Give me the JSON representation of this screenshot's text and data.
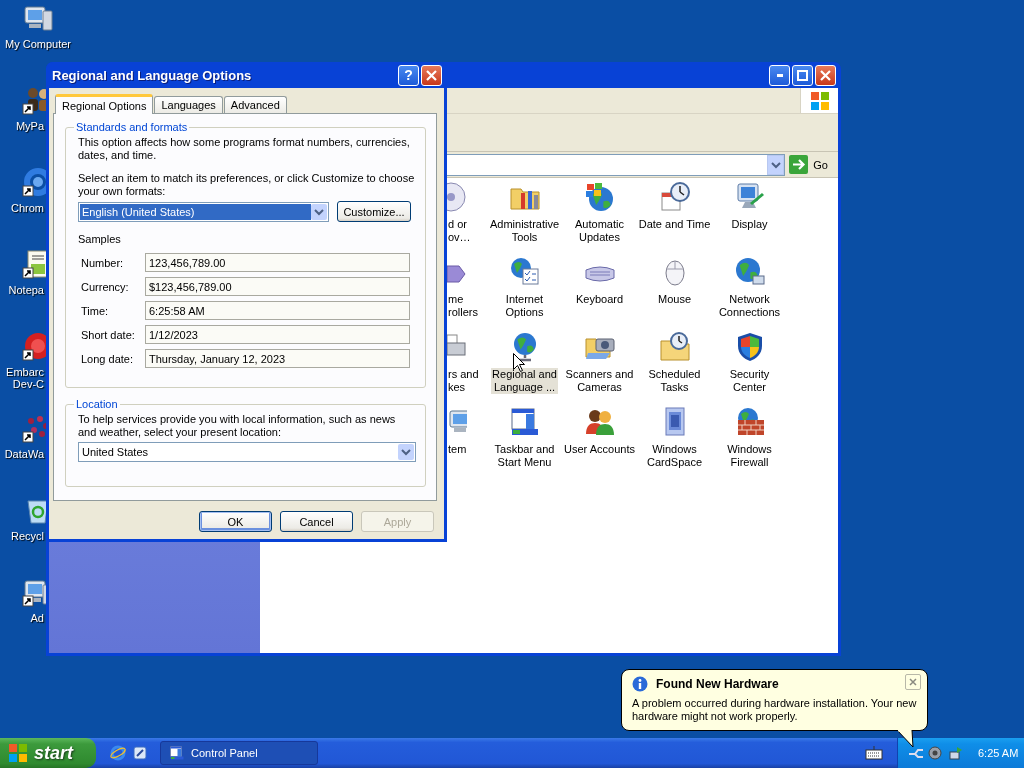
{
  "desktop_icons": [
    {
      "kind": "computer",
      "shortcut": false,
      "cut": false,
      "lines": [
        "My Computer"
      ]
    },
    {
      "kind": "figures",
      "shortcut": true,
      "cut": true,
      "lines": [
        "MyPa"
      ]
    },
    {
      "kind": "ring",
      "shortcut": true,
      "cut": true,
      "lines": [
        "Chrom"
      ]
    },
    {
      "kind": "notepad",
      "shortcut": true,
      "cut": true,
      "lines": [
        "Notepa"
      ]
    },
    {
      "kind": "badge",
      "shortcut": true,
      "cut": true,
      "lines": [
        "Embarc",
        "Dev-C"
      ]
    },
    {
      "kind": "dots",
      "shortcut": true,
      "cut": true,
      "lines": [
        "DataWa"
      ]
    },
    {
      "kind": "recycle",
      "shortcut": false,
      "cut": true,
      "lines": [
        "Recycl"
      ]
    },
    {
      "kind": "computer",
      "shortcut": true,
      "cut": true,
      "lines": [
        "Ad"
      ]
    }
  ],
  "control_panel": {
    "go_label": "Go",
    "items": [
      {
        "kind": "disc",
        "cut": true,
        "selected": false,
        "lines": [
          "d or",
          "ov…"
        ]
      },
      {
        "kind": "tools",
        "cut": false,
        "selected": false,
        "lines": [
          "Administrative",
          "Tools"
        ]
      },
      {
        "kind": "flag-globe",
        "cut": false,
        "selected": false,
        "lines": [
          "Automatic",
          "Updates"
        ]
      },
      {
        "kind": "clock",
        "cut": false,
        "selected": false,
        "lines": [
          "Date and Time"
        ]
      },
      {
        "kind": "monitor",
        "cut": false,
        "selected": false,
        "lines": [
          "Display"
        ]
      },
      {
        "kind": "gamepad",
        "cut": true,
        "selected": false,
        "lines": [
          "me",
          "rollers"
        ]
      },
      {
        "kind": "globe-list",
        "cut": false,
        "selected": false,
        "lines": [
          "Internet",
          "Options"
        ]
      },
      {
        "kind": "keyboard",
        "cut": false,
        "selected": false,
        "lines": [
          "Keyboard"
        ]
      },
      {
        "kind": "mouse",
        "cut": false,
        "selected": false,
        "lines": [
          "Mouse"
        ]
      },
      {
        "kind": "globe-net",
        "cut": false,
        "selected": false,
        "lines": [
          "Network",
          "Connections"
        ]
      },
      {
        "kind": "printer",
        "cut": true,
        "selected": false,
        "lines": [
          "rs and",
          "kes"
        ]
      },
      {
        "kind": "globe-stand",
        "cut": false,
        "selected": true,
        "lines": [
          "Regional and",
          "Language ..."
        ]
      },
      {
        "kind": "camera",
        "cut": false,
        "selected": false,
        "lines": [
          "Scanners and",
          "Cameras"
        ]
      },
      {
        "kind": "folder-clock",
        "cut": false,
        "selected": false,
        "lines": [
          "Scheduled",
          "Tasks"
        ]
      },
      {
        "kind": "shield",
        "cut": false,
        "selected": false,
        "lines": [
          "Security",
          "Center"
        ]
      },
      {
        "kind": "computer",
        "cut": true,
        "selected": false,
        "lines": [
          "tem"
        ]
      },
      {
        "kind": "taskbar",
        "cut": false,
        "selected": false,
        "lines": [
          "Taskbar and",
          "Start Menu"
        ]
      },
      {
        "kind": "people",
        "cut": false,
        "selected": false,
        "lines": [
          "User Accounts"
        ]
      },
      {
        "kind": "card",
        "cut": false,
        "selected": false,
        "lines": [
          "Windows",
          "CardSpace"
        ]
      },
      {
        "kind": "firewall",
        "cut": false,
        "selected": false,
        "lines": [
          "Windows",
          "Firewall"
        ]
      }
    ]
  },
  "dialog": {
    "title": "Regional and Language Options",
    "help_label": "?",
    "tabs": [
      {
        "label": "Regional Options",
        "selected": true
      },
      {
        "label": "Languages",
        "selected": false
      },
      {
        "label": "Advanced",
        "selected": false
      }
    ],
    "standards": {
      "legend": "Standards and formats",
      "description": "This option affects how some programs format numbers, currencies, dates, and time.",
      "prompt": "Select an item to match its preferences, or click Customize to choose your own formats:",
      "format": {
        "value": "English (United States)",
        "focused": true
      },
      "customize_label": "Customize...",
      "samples_label": "Samples",
      "samples": [
        {
          "label": "Number:",
          "value": "123,456,789.00"
        },
        {
          "label": "Currency:",
          "value": "$123,456,789.00"
        },
        {
          "label": "Time:",
          "value": "6:25:58 AM"
        },
        {
          "label": "Short date:",
          "value": "1/12/2023"
        },
        {
          "label": "Long date:",
          "value": "Thursday, January 12, 2023"
        }
      ]
    },
    "location": {
      "legend": "Location",
      "description": "To help services provide you with local information, such as news and weather, select your present location:",
      "value": "United States"
    },
    "buttons": [
      {
        "label": "OK",
        "default": true,
        "disabled": false
      },
      {
        "label": "Cancel",
        "default": false,
        "disabled": false
      },
      {
        "label": "Apply",
        "default": false,
        "disabled": true
      }
    ]
  },
  "balloon": {
    "title": "Found New Hardware",
    "message": "A problem occurred during hardware installation. Your new hardware might not work properly."
  },
  "taskbar": {
    "start_label": "start",
    "tasks": [
      {
        "label": "Control Panel",
        "selected": true
      }
    ],
    "clock": "6:25 AM"
  }
}
